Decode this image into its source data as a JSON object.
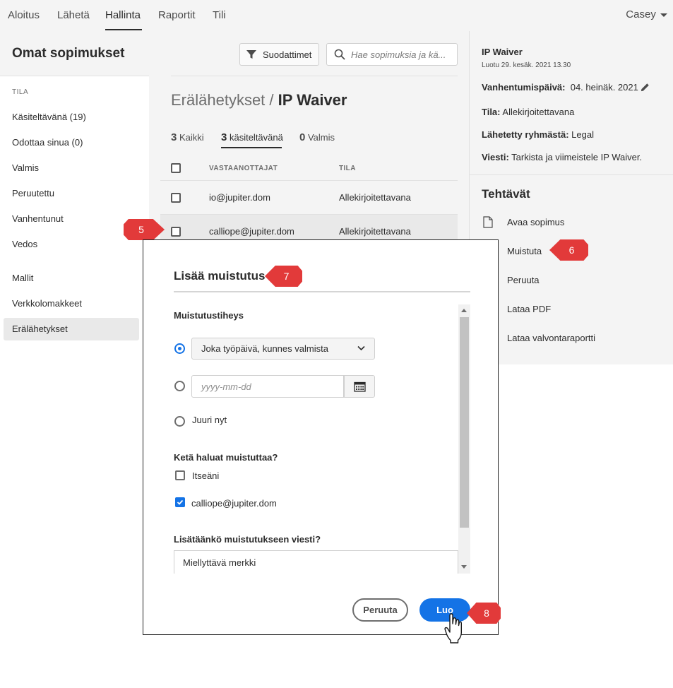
{
  "nav": {
    "items": [
      "Aloitus",
      "Lähetä",
      "Hallinta",
      "Raportit",
      "Tili"
    ],
    "user": "Casey"
  },
  "header": {
    "title": "Omat sopimukset",
    "filter_label": "Suodattimet",
    "search_placeholder": "Hae sopimuksia ja kä..."
  },
  "sidebar": {
    "heading": "TILA",
    "items": [
      "Käsiteltävänä (19)",
      "Odottaa sinua (0)",
      "Valmis",
      "Peruutettu",
      "Vanhentunut",
      "Vedos",
      "Mallit",
      "Verkkolomakkeet",
      "Erälähetykset"
    ],
    "selected": "Erälähetykset"
  },
  "main": {
    "breadcrumb_parent": "Erälähetykset / ",
    "breadcrumb_current": "IP Waiver",
    "tabs": [
      {
        "count": "3",
        "label": "Kaikki"
      },
      {
        "count": "3",
        "label": "käsiteltävänä"
      },
      {
        "count": "0",
        "label": "Valmis"
      }
    ],
    "columns": [
      "VASTAANOTTAJAT",
      "TILA"
    ],
    "rows": [
      {
        "recipient": "io@jupiter.dom",
        "status": "Allekirjoitettavana"
      },
      {
        "recipient": "calliope@jupiter.dom",
        "status": "Allekirjoitettavana"
      }
    ]
  },
  "details": {
    "title": "IP Waiver",
    "created": "Luotu 29. kesäk. 2021 13.30",
    "expiry_label": "Vanhentumispäivä:",
    "expiry_value": "04. heinäk. 2021",
    "status_label": "Tila:",
    "status_value": "Allekirjoitettavana",
    "group_label": "Lähetetty ryhmästä:",
    "group_value": "Legal",
    "message_label": "Viesti:",
    "message_value": "Tarkista ja viimeistele IP Waiver.",
    "tasks_heading": "Tehtävät",
    "tasks": [
      "Avaa sopimus",
      "Muistuta",
      "Peruuta",
      "Lataa PDF",
      "Lataa valvontaraportti"
    ]
  },
  "modal": {
    "title": "Lisää muistutus",
    "frequency_label": "Muistutustiheys",
    "frequency_selected": "Joka työpäivä, kunnes valmista",
    "date_placeholder": "yyyy-mm-dd",
    "now_option": "Juuri nyt",
    "who_label": "Ketä haluat muistuttaa?",
    "who_options": [
      {
        "label": "Itseäni",
        "checked": false
      },
      {
        "label": "calliope@jupiter.dom",
        "checked": true
      }
    ],
    "message_label": "Lisätäänkö muistutukseen viesti?",
    "message_value": "Miellyttävä merkki",
    "cancel_label": "Peruuta",
    "create_label": "Luo"
  },
  "callouts": [
    "5",
    "6",
    "7",
    "8"
  ],
  "colors": {
    "accent": "#1473e6",
    "callout": "#e23a3a",
    "panel_bg": "#f4f4f4"
  }
}
